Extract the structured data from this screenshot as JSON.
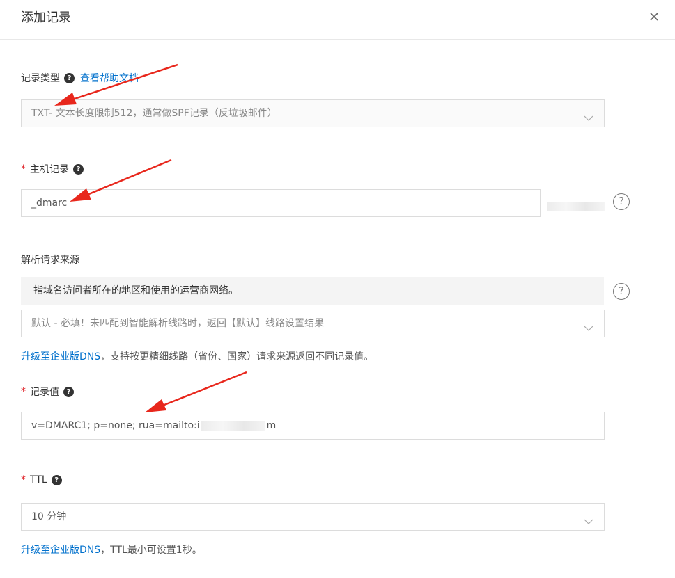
{
  "dialog": {
    "title": "添加记录"
  },
  "record_type": {
    "label": "记录类型",
    "help_link": "查看帮助文档",
    "value": "TXT- 文本长度限制512，通常做SPF记录（反垃圾邮件）"
  },
  "host_record": {
    "label": "主机记录",
    "value": "_dmarc"
  },
  "resolution_source": {
    "label": "解析请求来源",
    "tip": "指域名访问者所在的地区和使用的运营商网络。",
    "value": "默认 - 必填！未匹配到智能解析线路时，返回【默认】线路设置结果",
    "upgrade_link": "升级至企业版DNS",
    "upgrade_text": "，支持按更精细线路（省份、国家）请求来源返回不同记录值。"
  },
  "record_value": {
    "label": "记录值",
    "value_prefix": "v=DMARC1; p=none; rua=mailto:i",
    "value_suffix": "m"
  },
  "ttl": {
    "label": "TTL",
    "value": "10 分钟",
    "upgrade_link": "升级至企业版DNS",
    "upgrade_text": "，TTL最小可设置1秒。"
  },
  "colors": {
    "link": "#0070cc",
    "required": "#e0242a",
    "annotation_arrow": "#e8271c"
  },
  "icons": [
    "close-icon",
    "help-icon",
    "chevron-down-icon",
    "question-circle-icon"
  ]
}
